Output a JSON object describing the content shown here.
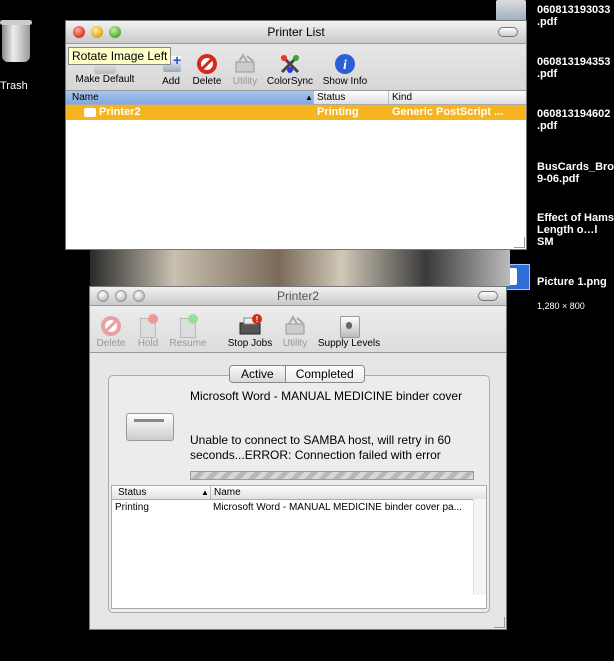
{
  "desktop": {
    "trash_label": "Trash",
    "files": [
      {
        "name": "060813193033\n.pdf",
        "sub": ""
      },
      {
        "name": "060813194353\n.pdf",
        "sub": ""
      },
      {
        "name": "060813194602\n.pdf",
        "sub": ""
      },
      {
        "name": "BusCards_Bron\n9-06.pdf",
        "sub": ""
      },
      {
        "name": "Effect of Hams\nLength o…l SM",
        "sub": ""
      },
      {
        "name": "Picture 1.png",
        "sub": "1,280 × 800"
      }
    ]
  },
  "printer_list": {
    "title": "Printer List",
    "tooltip": "Rotate Image Left",
    "toolbar": {
      "make_default": "Make Default",
      "add": "Add",
      "delete": "Delete",
      "utility": "Utility",
      "colorsync": "ColorSync",
      "show_info": "Show Info"
    },
    "columns": {
      "name": "Name",
      "status": "Status",
      "kind": "Kind"
    },
    "rows": [
      {
        "name": "Printer2",
        "status": "Printing",
        "kind": "Generic PostScript ..."
      }
    ]
  },
  "queue": {
    "title": "Printer2",
    "toolbar": {
      "delete": "Delete",
      "hold": "Hold",
      "resume": "Resume",
      "stop_jobs": "Stop Jobs",
      "utility": "Utility",
      "supply_levels": "Supply Levels"
    },
    "tabs": {
      "active": "Active",
      "completed": "Completed"
    },
    "job_title": "Microsoft Word - MANUAL MEDICINE binder cover",
    "job_message": "Unable to connect to SAMBA host, will retry in 60 seconds...ERROR:  Connection failed with error",
    "columns": {
      "status": "Status",
      "name": "Name"
    },
    "rows": [
      {
        "status": "Printing",
        "name": "Microsoft Word - MANUAL MEDICINE binder cover pa..."
      }
    ]
  },
  "colors": {
    "selection": "#f6b520",
    "selection_text": "#ffffff",
    "name_header": "#7fa8e0"
  }
}
